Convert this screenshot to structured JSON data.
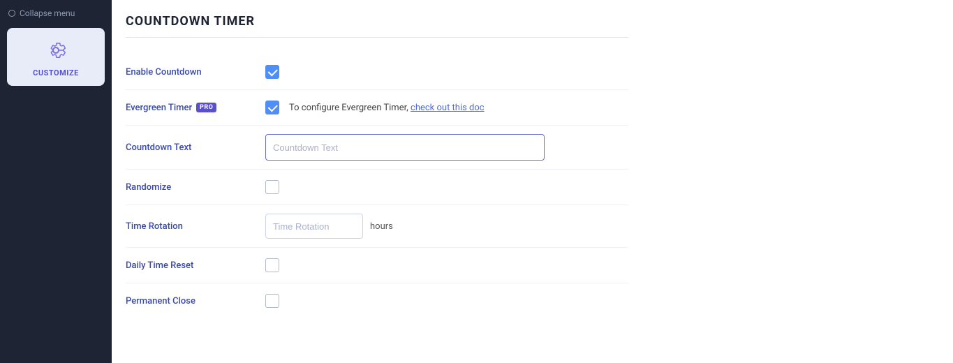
{
  "sidebar": {
    "collapse_label": "Collapse menu",
    "customize_label": "CUSTOMIZE"
  },
  "page": {
    "title": "COUNTDOWN TIMER"
  },
  "form": {
    "enable_countdown": {
      "label": "Enable Countdown",
      "checked": true
    },
    "evergreen_timer": {
      "label": "Evergreen Timer",
      "pro_badge": "PRO",
      "checked": true,
      "helper_text": "To configure Evergreen Timer,",
      "link_text": "check out this doc"
    },
    "countdown_text": {
      "label": "Countdown Text",
      "placeholder": "Countdown Text"
    },
    "randomize": {
      "label": "Randomize",
      "checked": false
    },
    "time_rotation": {
      "label": "Time Rotation",
      "placeholder": "Time Rotation",
      "suffix": "hours"
    },
    "daily_time_reset": {
      "label": "Daily Time Reset",
      "checked": false
    },
    "permanent_close": {
      "label": "Permanent Close",
      "checked": false
    }
  }
}
